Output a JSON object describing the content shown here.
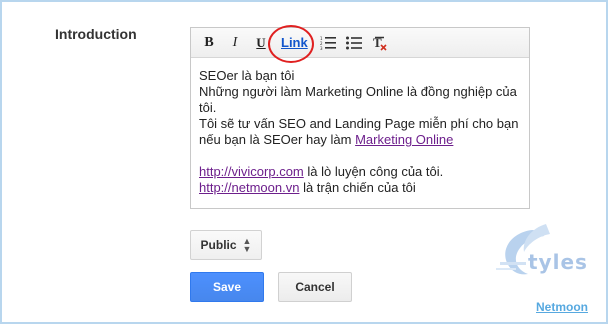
{
  "section": {
    "label": "Introduction"
  },
  "toolbar": {
    "bold": "B",
    "italic": "I",
    "underline": "U",
    "link": "Link",
    "numbered_list_icon": "numbered-list-icon",
    "bulleted_list_icon": "bulleted-list-icon",
    "clear_format_icon": "clear-format-icon"
  },
  "content": {
    "line1": "SEOer là bạn tôi",
    "line2": "Những người làm Marketing Online là đồng nghiệp của tôi.",
    "line3_text": "Tôi sẽ tư vấn SEO and Landing Page miễn phí cho bạn nếu bạn là SEOer hay làm ",
    "line3_link": "Marketing Online",
    "link1": "http://vivicorp.com",
    "line4_rest": " là lò luyện công của tôi.",
    "link2": "http://netmoon.vn",
    "line5_rest": " là trận chiến của tôi"
  },
  "privacy": {
    "value": "Public"
  },
  "actions": {
    "save": "Save",
    "cancel": "Cancel"
  },
  "watermark": {
    "styles": "tyles",
    "netmoon": "Netmoon"
  },
  "colors": {
    "accent": "#4d90fe",
    "link_visited": "#6d1f8c",
    "annotation_circle": "#e02020"
  }
}
